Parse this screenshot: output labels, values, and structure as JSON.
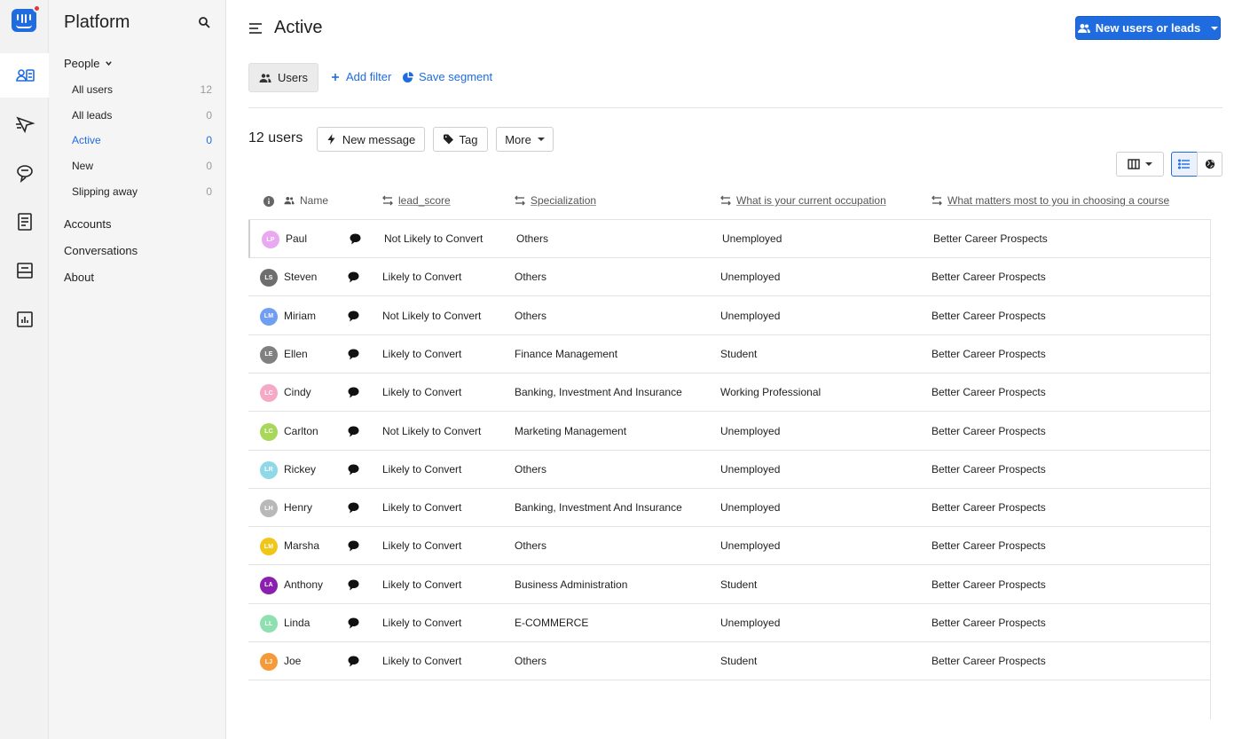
{
  "app": {
    "title": "Platform"
  },
  "colors": {
    "accent": "#1f6ce0",
    "notification": "#e8333b"
  },
  "rail": {
    "icons": [
      "contacts-icon",
      "outbound-icon",
      "conversations-icon",
      "articles-icon",
      "inbox-icon",
      "reports-icon"
    ]
  },
  "sidebar": {
    "group_label": "People",
    "items": [
      {
        "label": "All users",
        "count": "12"
      },
      {
        "label": "All leads",
        "count": "0"
      },
      {
        "label": "Active",
        "count": "0"
      },
      {
        "label": "New",
        "count": "0"
      },
      {
        "label": "Slipping away",
        "count": "0"
      }
    ],
    "sections": [
      "Accounts",
      "Conversations",
      "About"
    ]
  },
  "header": {
    "title": "Active",
    "primary_button": "New users or leads"
  },
  "filters": {
    "users_pill": "Users",
    "add_filter": "Add filter",
    "save_segment": "Save segment"
  },
  "toolbar": {
    "count_label": "12 users",
    "new_message": "New message",
    "tag": "Tag",
    "more": "More"
  },
  "table": {
    "columns": [
      "Name",
      "lead_score",
      "Specialization",
      "What is your current occupation",
      "What matters most to you in choosing a course"
    ],
    "rows": [
      {
        "initials": "LP",
        "color": "#e9a8f0",
        "name": "Paul",
        "lead_score": "Not Likely to Convert",
        "specialization": "Others",
        "occupation": "Unemployed",
        "matters": "Better Career Prospects"
      },
      {
        "initials": "LS",
        "color": "#6e6e6e",
        "name": "Steven",
        "lead_score": "Likely to Convert",
        "specialization": "Others",
        "occupation": "Unemployed",
        "matters": "Better Career Prospects"
      },
      {
        "initials": "LM",
        "color": "#6f9ef2",
        "name": "Miriam",
        "lead_score": "Not Likely to Convert",
        "specialization": "Others",
        "occupation": "Unemployed",
        "matters": "Better Career Prospects"
      },
      {
        "initials": "LE",
        "color": "#808080",
        "name": "Ellen",
        "lead_score": "Likely to Convert",
        "specialization": "Finance Management",
        "occupation": "Student",
        "matters": "Better Career Prospects"
      },
      {
        "initials": "LC",
        "color": "#f5a9c6",
        "name": "Cindy",
        "lead_score": "Likely to Convert",
        "specialization": "Banking, Investment And Insurance",
        "occupation": "Working Professional",
        "matters": "Better Career Prospects"
      },
      {
        "initials": "LC",
        "color": "#a8d85a",
        "name": "Carlton",
        "lead_score": "Not Likely to Convert",
        "specialization": "Marketing Management",
        "occupation": "Unemployed",
        "matters": "Better Career Prospects"
      },
      {
        "initials": "LR",
        "color": "#8fd8e8",
        "name": "Rickey",
        "lead_score": "Likely to Convert",
        "specialization": "Others",
        "occupation": "Unemployed",
        "matters": "Better Career Prospects"
      },
      {
        "initials": "LH",
        "color": "#b8b8b8",
        "name": "Henry",
        "lead_score": "Likely to Convert",
        "specialization": "Banking, Investment And Insurance",
        "occupation": "Unemployed",
        "matters": "Better Career Prospects"
      },
      {
        "initials": "LM",
        "color": "#f0c61a",
        "name": "Marsha",
        "lead_score": "Likely to Convert",
        "specialization": "Others",
        "occupation": "Unemployed",
        "matters": "Better Career Prospects"
      },
      {
        "initials": "LA",
        "color": "#8a1fb0",
        "name": "Anthony",
        "lead_score": "Likely to Convert",
        "specialization": "Business Administration",
        "occupation": "Student",
        "matters": "Better Career Prospects"
      },
      {
        "initials": "LL",
        "color": "#8fe0b0",
        "name": "Linda",
        "lead_score": "Likely to Convert",
        "specialization": "E-COMMERCE",
        "occupation": "Unemployed",
        "matters": "Better Career Prospects"
      },
      {
        "initials": "LJ",
        "color": "#f59a3a",
        "name": "Joe",
        "lead_score": "Likely to Convert",
        "specialization": "Others",
        "occupation": "Student",
        "matters": "Better Career Prospects"
      }
    ]
  }
}
